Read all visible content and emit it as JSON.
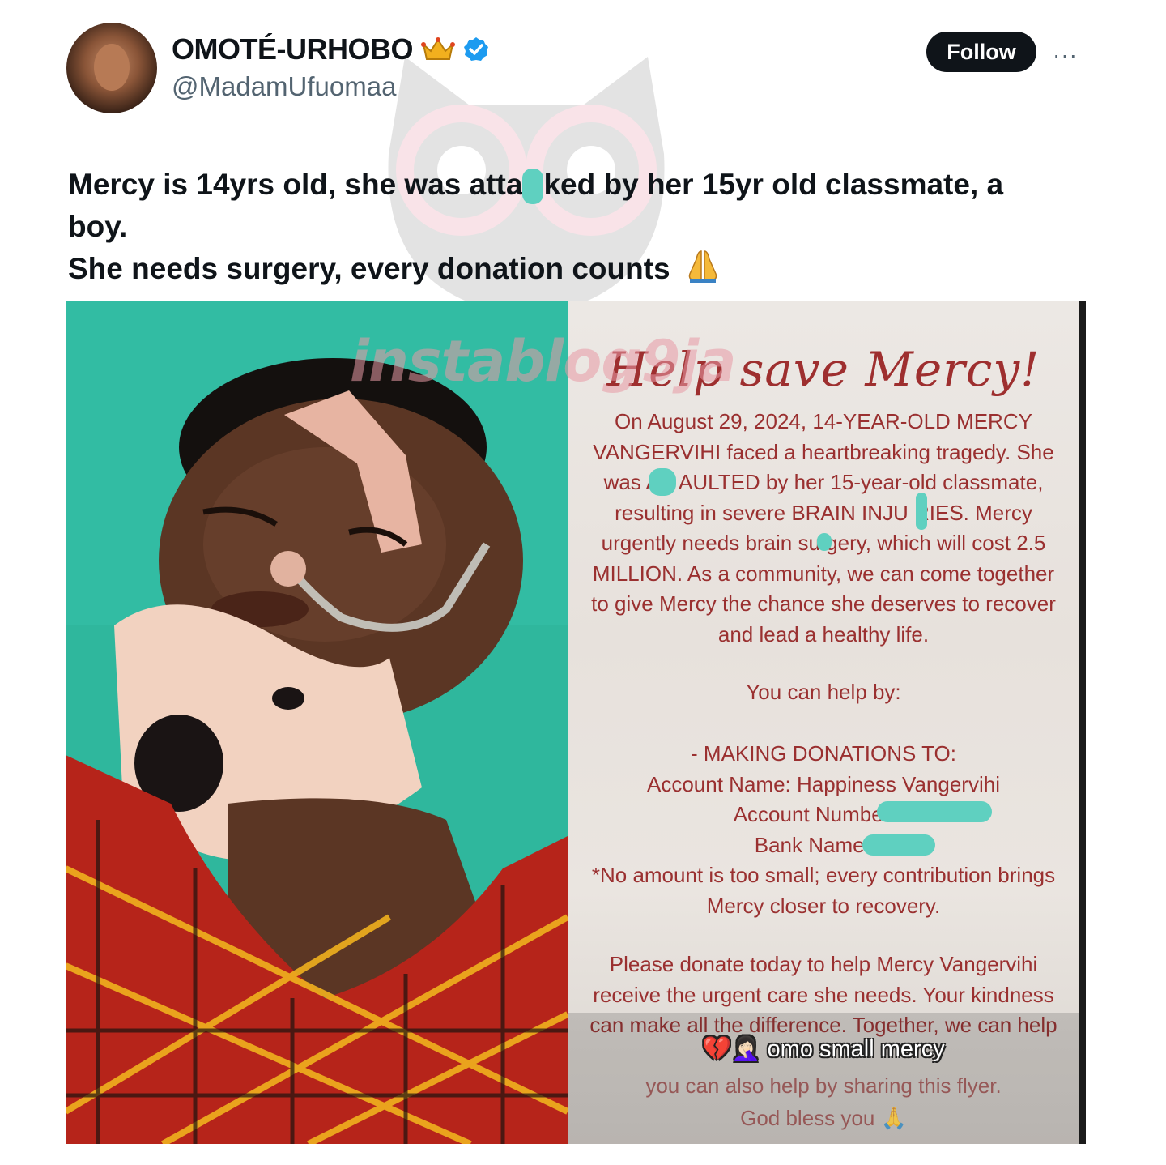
{
  "tweet": {
    "author": {
      "display_name": "OMOTÉ-URHOBO",
      "handle": "@MadamUfuomaa",
      "badges": [
        "crown-icon",
        "verified-icon"
      ]
    },
    "follow_label": "Follow",
    "more_label": "···",
    "text_line1_a": "Mercy is 14yrs old, she was atta",
    "text_line1_b": "ked by her 15yr old classmate, a",
    "text_line2": "boy.",
    "text_line3": "She needs surgery, every donation counts"
  },
  "watermark": "instablog9ja",
  "flyer": {
    "title": "Help save Mercy!",
    "paragraph_lines": [
      "On August 29, 2024, 14-YEAR-OLD MERCY",
      "VANGERVIHI faced a heartbreaking tragedy. She",
      "was AS  AULTED by her 15-year-old classmate,",
      "resulting in severe BRAIN INJU RIES. Mercy",
      "urgently needs brain su gery, which will cost 2.5",
      "MILLION. As a community, we can come together",
      "to give Mercy the chance she deserves to recover",
      "and lead a healthy life."
    ],
    "help_heading": "You can help by:",
    "donation_lines": [
      "- MAKING DONATIONS TO:",
      "Account Name: Happiness Vangervihi",
      "Account Number: 8",
      "Bank Name: O",
      "*No amount is too small; every contribution brings",
      "Mercy closer to recovery."
    ],
    "appeal_lines": [
      "Please donate today to help Mercy Vangervihi",
      "receive the urgent care she needs. Your kindness",
      "can make all the difference. Together, we can help"
    ],
    "sticker_caption": "💔🤦🏻‍♀️ omo small mercy",
    "footer_lines": [
      "you can also help by sharing this flyer.",
      "God bless you 🙏"
    ]
  },
  "colors": {
    "follow_bg": "#0f1419",
    "verified": "#1d9bf0",
    "handle": "#536471",
    "flyer_text": "#9a3030",
    "redaction": "#5fd0c0",
    "photo_bg": "#2fb79d"
  }
}
